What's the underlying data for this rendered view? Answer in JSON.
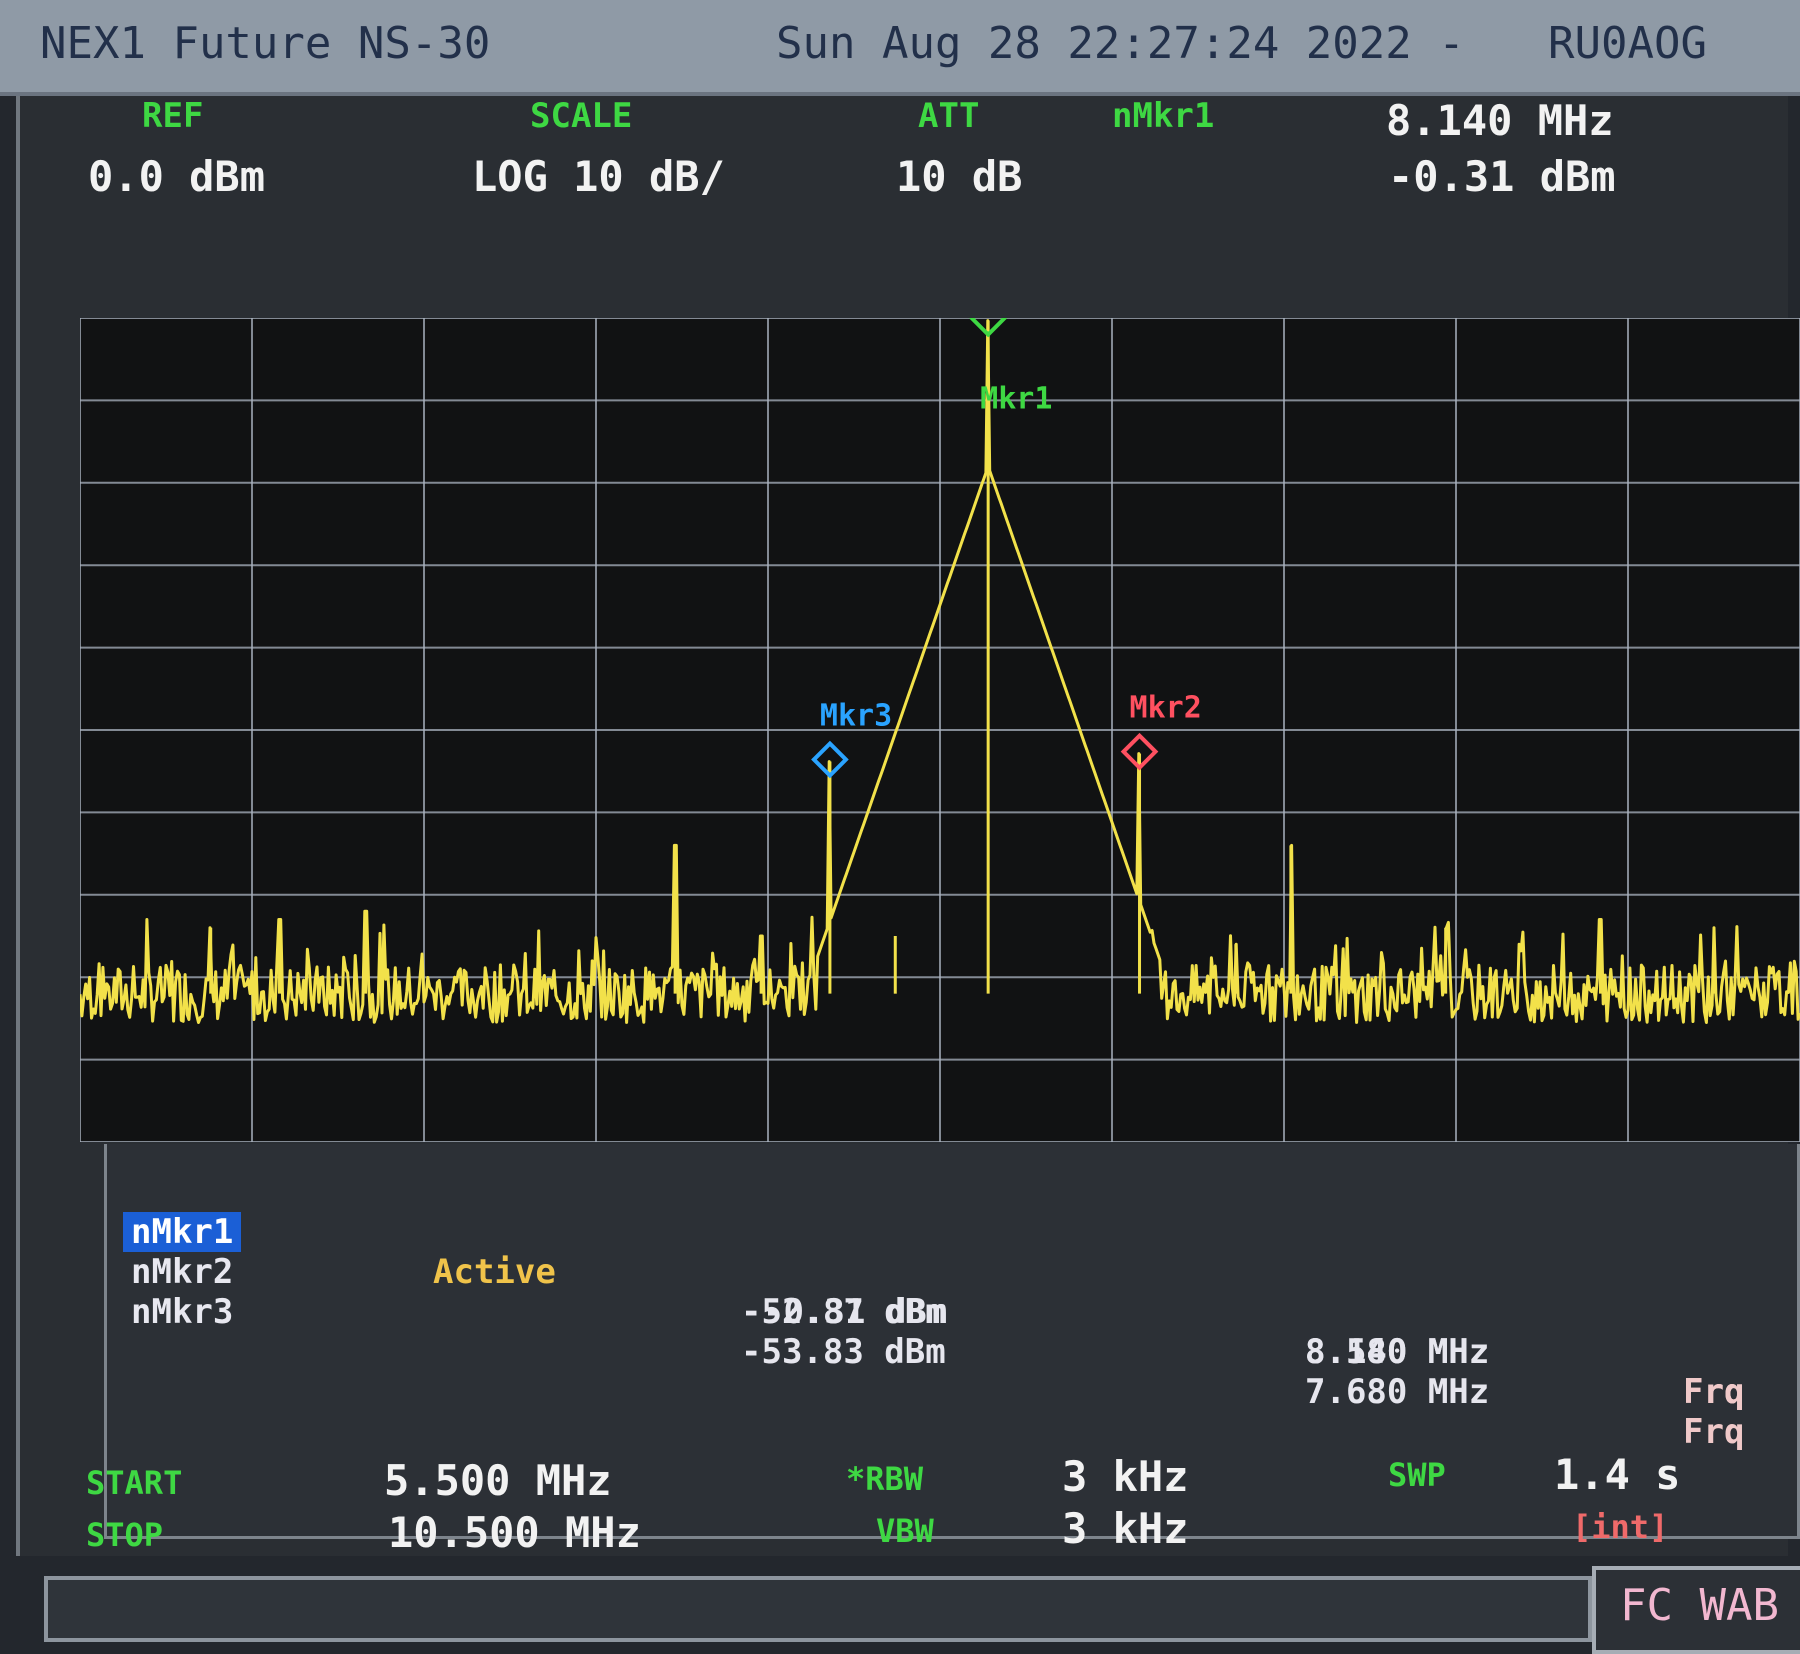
{
  "title_bar": {
    "instrument": "NEX1 Future NS-30",
    "datetime": "Sun Aug 28 22:27:24 2022 -",
    "callsign": "RU0AOG"
  },
  "header": {
    "ref_label": "REF",
    "ref_value": "0.0 dBm",
    "scale_label": "SCALE",
    "scale_value": "LOG 10 dB/",
    "att_label": "ATT",
    "att_value": "10 dB",
    "active_marker_label": "nMkr1",
    "active_marker_freq": "8.140 MHz",
    "active_marker_level": "-0.31 dBm"
  },
  "chart_data": {
    "type": "line",
    "title": "",
    "xlabel": "",
    "ylabel": "",
    "x_unit": "MHz",
    "y_unit": "dBm",
    "xlim": [
      5.5,
      10.5
    ],
    "ylim": [
      -100,
      0
    ],
    "grid": true,
    "noise_floor_dbm": -82,
    "series": [
      {
        "name": "",
        "color": "#f2e14a",
        "spurs": [
          {
            "x": 5.88,
            "y": -74
          },
          {
            "x": 6.08,
            "y": -73
          },
          {
            "x": 6.33,
            "y": -72
          },
          {
            "x": 7.23,
            "y": -64
          },
          {
            "x": 7.48,
            "y": -75
          },
          {
            "x": 7.68,
            "y": -53.83
          },
          {
            "x": 7.87,
            "y": -75
          },
          {
            "x": 8.14,
            "y": -0.31
          },
          {
            "x": 8.58,
            "y": -52.87
          },
          {
            "x": 8.86,
            "y": -76
          },
          {
            "x": 9.02,
            "y": -64
          },
          {
            "x": 9.47,
            "y": -74
          },
          {
            "x": 9.92,
            "y": -73
          },
          {
            "x": 10.25,
            "y": -74
          }
        ]
      }
    ],
    "markers": [
      {
        "label": "Mkr1",
        "x": 8.14,
        "y": -0.31,
        "color": "#3ed843"
      },
      {
        "label": "Mkr2",
        "x": 8.58,
        "y": -52.87,
        "color": "#ff5060"
      },
      {
        "label": "Mkr3",
        "x": 7.68,
        "y": -53.83,
        "color": "#2aa3ff"
      }
    ]
  },
  "marker_table": {
    "rows": [
      {
        "name": "nMkr1",
        "state": "Active",
        "level": "-0.31 dBm",
        "freq": "8.140 MHz",
        "mode": "Frq",
        "active": true
      },
      {
        "name": "nMkr2",
        "state": "",
        "level": "-52.87 dBm",
        "freq": "8.580 MHz",
        "mode": "Frq",
        "active": false
      },
      {
        "name": "nMkr3",
        "state": "",
        "level": "-53.83 dBm",
        "freq": "7.680 MHz",
        "mode": "Frq",
        "active": false
      }
    ]
  },
  "footer": {
    "start_label": "START",
    "start_value": "5.500 MHz",
    "stop_label": "STOP",
    "stop_value": "10.500 MHz",
    "rbw_label": "*RBW",
    "rbw_value": "3 kHz",
    "vbw_label": "VBW",
    "vbw_value": "3 kHz",
    "swp_label": "SWP",
    "swp_value": "1.4 s",
    "swp_mode": "[int]"
  },
  "corner_box": "FC WAB"
}
